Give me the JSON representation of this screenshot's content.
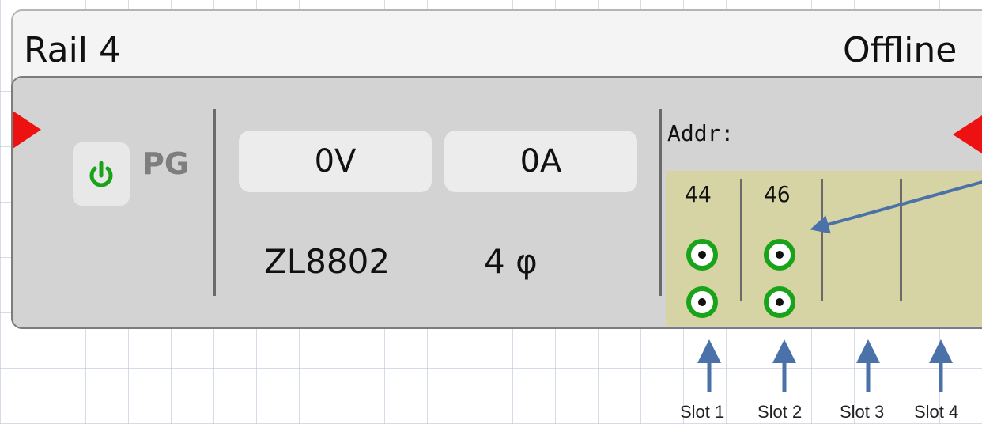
{
  "rail": {
    "title": "Rail 4",
    "status": "Offline"
  },
  "power": {
    "icon": "power-icon",
    "icon_color": "#19a319",
    "label": "PG"
  },
  "readings": {
    "voltage": "0V",
    "current": "0A",
    "model": "ZL8802",
    "phase": "4 φ"
  },
  "address": {
    "label": "Addr:",
    "slots": [
      {
        "addr": "44"
      },
      {
        "addr": "46"
      },
      {
        "addr": ""
      },
      {
        "addr": ""
      }
    ]
  },
  "annotations": {
    "slot_labels": [
      "Slot 1",
      "Slot 2",
      "Slot 3",
      "Slot 4"
    ],
    "arrow_color": "#4a72a8"
  },
  "colors": {
    "indicator_red": "#ee1111",
    "connector_green": "#19a319",
    "slot_area_bg": "#d6d4a4"
  }
}
